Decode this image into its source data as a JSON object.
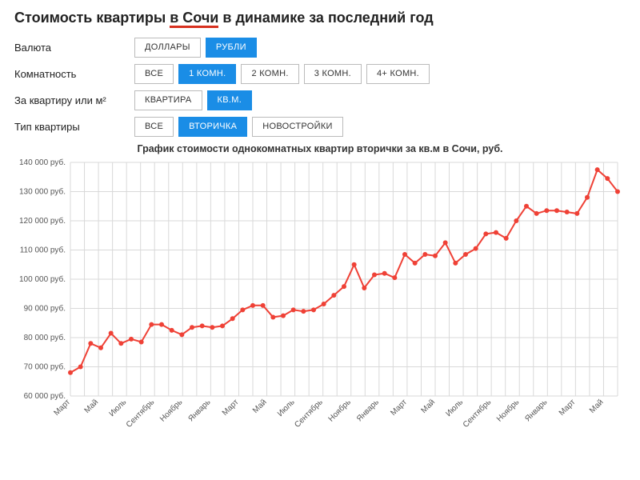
{
  "heading": {
    "pre": "Стоимость квартиры ",
    "city": "в Сочи",
    "post": " в динамике за последний год"
  },
  "filters": {
    "currency": {
      "label": "Валюта",
      "options": [
        "ДОЛЛАРЫ",
        "РУБЛИ"
      ],
      "active": 1
    },
    "rooms": {
      "label": "Комнатность",
      "options": [
        "ВСЕ",
        "1 КОМН.",
        "2 КОМН.",
        "3 КОМН.",
        "4+ КОМН."
      ],
      "active": 1
    },
    "unit": {
      "label": "За квартиру или м²",
      "options": [
        "КВАРТИРА",
        "КВ.М."
      ],
      "active": 1
    },
    "type": {
      "label": "Тип квартиры",
      "options": [
        "ВСЕ",
        "ВТОРИЧКА",
        "НОВОСТРОЙКИ"
      ],
      "active": 1
    }
  },
  "chart_data": {
    "type": "line",
    "title": "График стоимости однокомнатных квартир вторички за кв.м в Сочи, руб.",
    "ylabel": "руб.",
    "ylim": [
      60000,
      140000
    ],
    "yticks": [
      60000,
      70000,
      80000,
      90000,
      100000,
      110000,
      120000,
      130000,
      140000
    ],
    "ytick_labels": [
      "60 000 руб.",
      "70 000 руб.",
      "80 000 руб.",
      "90 000 руб.",
      "100 000 руб.",
      "110 000 руб.",
      "120 000 руб.",
      "130 000 руб.",
      "140 000 руб."
    ],
    "x_labels": [
      "Март",
      "",
      "Май",
      "",
      "Июль",
      "",
      "Сентябрь",
      "",
      "Ноябрь",
      "",
      "Январь",
      "",
      "Март",
      "",
      "Май",
      "",
      "Июль",
      "",
      "Сентябрь",
      "",
      "Ноябрь",
      "",
      "Январь",
      "",
      "Март",
      "",
      "Май",
      "",
      "Июль",
      "",
      "Сентябрь",
      "",
      "Ноябрь",
      "",
      "Январь",
      "",
      "Март",
      "",
      "Май",
      ""
    ],
    "values": [
      68000,
      70000,
      78000,
      76500,
      81500,
      78000,
      79500,
      78500,
      84500,
      84500,
      82500,
      81000,
      83500,
      84000,
      83500,
      84000,
      86500,
      89500,
      91000,
      91000,
      87000,
      87500,
      89500,
      89000,
      89500,
      91500,
      94500,
      97500,
      105000,
      97000,
      101500,
      102000,
      100500,
      108500,
      105500,
      108500,
      108000,
      112500,
      105500,
      108500,
      110500,
      115500,
      116000,
      114000,
      120000,
      125000,
      122500,
      123500,
      123500,
      123000,
      122500,
      128000,
      137500,
      134500,
      130000
    ]
  }
}
